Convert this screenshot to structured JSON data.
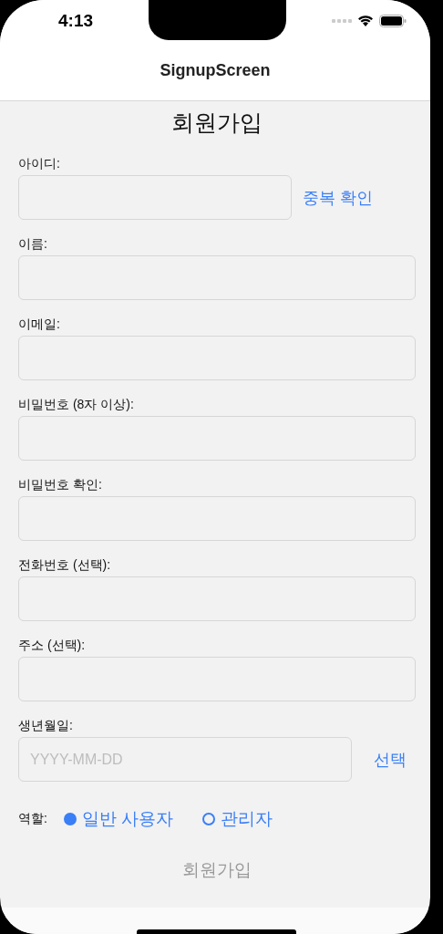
{
  "status_bar": {
    "time": "4:13"
  },
  "nav_bar": {
    "title": "SignupScreen"
  },
  "heading": "회원가입",
  "fields": [
    {
      "label": "아이디:",
      "kind": "with_button",
      "button": "중복 확인"
    },
    {
      "label": "이름:",
      "kind": "text"
    },
    {
      "label": "이메일:",
      "kind": "text"
    },
    {
      "label": "비밀번호 (8자 이상):",
      "kind": "text"
    },
    {
      "label": "비밀번호 확인:",
      "kind": "text"
    },
    {
      "label": "전화번호 (선택):",
      "kind": "text"
    },
    {
      "label": "주소 (선택):",
      "kind": "text"
    },
    {
      "label": "생년월일:",
      "kind": "with_button",
      "placeholder": "YYYY-MM-DD",
      "button": "선택"
    }
  ],
  "role": {
    "label": "역할:",
    "options": [
      {
        "label": "일반 사용자",
        "selected": true
      },
      {
        "label": "관리자",
        "selected": false
      }
    ]
  },
  "submit": {
    "label": "회원가입",
    "disabled": true
  }
}
